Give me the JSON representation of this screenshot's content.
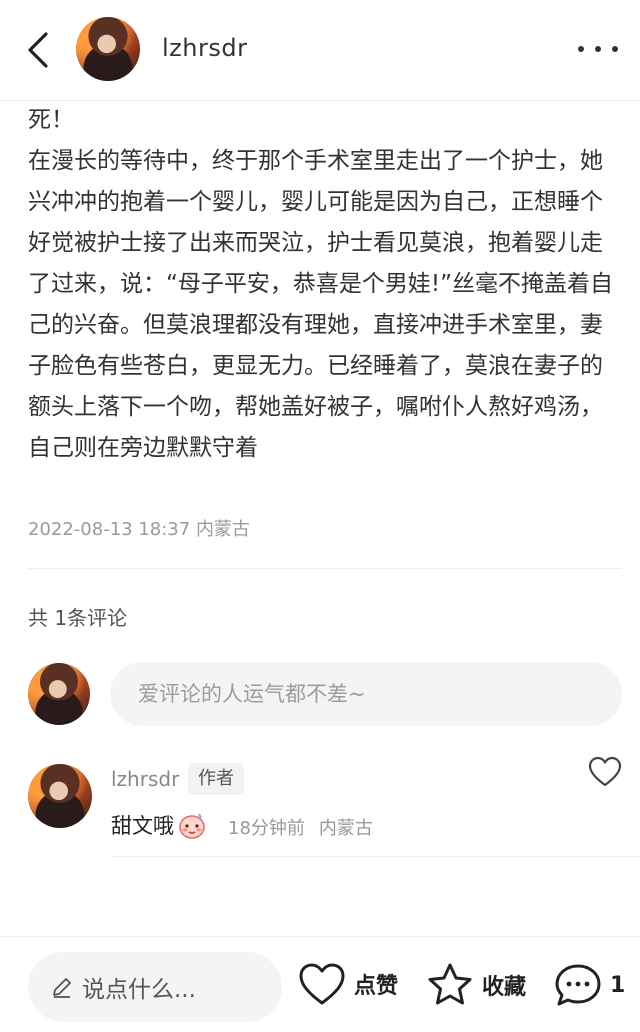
{
  "header": {
    "username": "lzhrsdr"
  },
  "post": {
    "text": "死！\n在漫长的等待中，终于那个手术室里走出了一个护士，她兴冲冲的抱着一个婴儿，婴儿可能是因为自己，正想睡个好觉被护士接了出来而哭泣，护士看见莫浪，抱着婴儿走了过来，说：“母子平安，恭喜是个男娃!”丝毫不掩盖着自己的兴奋。但莫浪理都没有理她，直接冲进手术室里，妻子脸色有些苍白，更显无力。已经睡着了，莫浪在妻子的额头上落下一个吻，帮她盖好被子，嘱咐仆人熬好鸡汤，自己则在旁边默默守着",
    "datetime": "2022-08-13 18:37",
    "location": "内蒙古"
  },
  "comments_section": {
    "count_label": "共 1条评论",
    "input_placeholder": "爱评论的人运气都不差~",
    "items": [
      {
        "username": "lzhrsdr",
        "badge": "作者",
        "content": "甜文哦",
        "time": "18分钟前",
        "location": "内蒙古"
      }
    ]
  },
  "bottom_bar": {
    "say_placeholder": "说点什么...",
    "like_label": "点赞",
    "favorite_label": "收藏",
    "comment_count": "1"
  },
  "colors": {
    "text": "#333333",
    "meta": "#9a9a9a",
    "input_bg": "#f4f4f4"
  }
}
